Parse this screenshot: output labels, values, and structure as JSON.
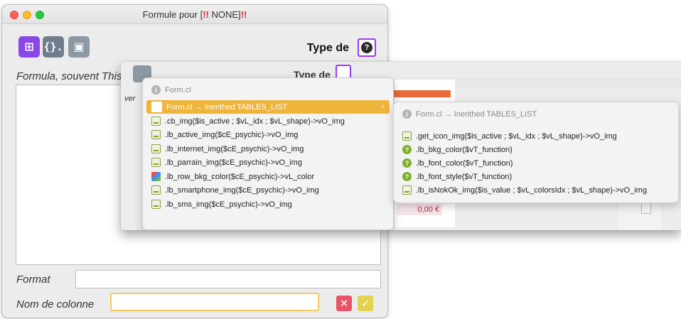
{
  "window": {
    "title_prefix": "Formule pour [",
    "title_bang1": "!!",
    "title_middle": " NONE]",
    "title_bang2": "!!",
    "toolbar": {
      "btn1_glyph": "⊞",
      "btn2_glyph": "{}.",
      "btn3_glyph": "▣"
    },
    "type_label": "Type de",
    "type_icon_glyph": "?",
    "formula_label": "Formula, souvent This.",
    "format_label": "Format",
    "column_label": "Nom de colonne",
    "cancel_glyph": "✕",
    "ok_glyph": "✓"
  },
  "overlay": {
    "behind_type_label": "Type de",
    "behind_ver_text": "ver",
    "behind_money": "0,00 €",
    "menu1": {
      "header": "Form.cl",
      "items": [
        {
          "label": "Form.cl → Inerithed TABLES_LIST",
          "icon": "list",
          "selected": true,
          "arrow": "›"
        },
        {
          "label": ".cb_img($is_active ; $vL_idx ; $vL_shape)->vO_img",
          "icon": "img"
        },
        {
          "label": ".lb_active_img($cE_psychic)->vO_img",
          "icon": "img"
        },
        {
          "label": ".lb_internet_img($cE_psychic)->vO_img",
          "icon": "img"
        },
        {
          "label": ".lb_parrain_img($cE_psychic)->vO_img",
          "icon": "img"
        },
        {
          "label": ".lb_row_bkg_color($cE_psychic)->vL_color",
          "icon": "color"
        },
        {
          "label": ".lb_smartphone_img($cE_psychic)->vO_img",
          "icon": "img"
        },
        {
          "label": ".lb_sms_img($cE_psychic)->vO_img",
          "icon": "img"
        }
      ]
    },
    "menu2": {
      "header": "Form.cl → Inerithed TABLES_LIST",
      "items": [
        {
          "label": ".get_icon_img($is_active ; $vL_idx ; $vL_shape)->vO_img",
          "icon": "img"
        },
        {
          "label": ".lb_bkg_color($vT_function)",
          "icon": "fn"
        },
        {
          "label": ".lb_font_color($vT_function)",
          "icon": "fn"
        },
        {
          "label": ".lb_font_style($vT_function)",
          "icon": "fn"
        },
        {
          "label": ".lb_isNokOk_img($is_value ; $vL_colorsIdx ; $vL_shape)->vO_img",
          "icon": "img"
        }
      ]
    }
  }
}
